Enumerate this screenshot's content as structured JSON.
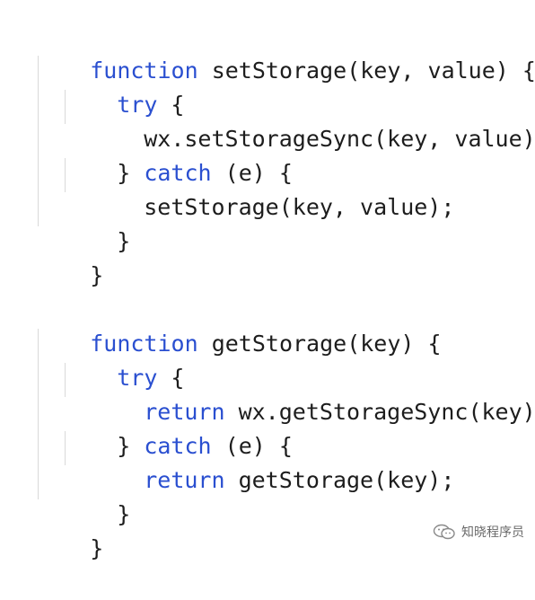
{
  "code": {
    "lines": [
      {
        "indent": 0,
        "keyword": "function",
        "text": " setStorage(key, value) {"
      },
      {
        "indent": 1,
        "keyword": "try",
        "text": " {"
      },
      {
        "indent": 2,
        "keyword": "",
        "text": "wx.setStorageSync(key, value);"
      },
      {
        "indent": 1,
        "keyword": "",
        "text": "} ",
        "keyword2": "catch",
        "text2": " (e) {"
      },
      {
        "indent": 2,
        "keyword": "",
        "text": "setStorage(key, value);"
      },
      {
        "indent": 1,
        "keyword": "",
        "text": "}"
      },
      {
        "indent": 0,
        "keyword": "",
        "text": "}"
      },
      {
        "indent": 0,
        "keyword": "",
        "text": ""
      },
      {
        "indent": 0,
        "keyword": "function",
        "text": " getStorage(key) {"
      },
      {
        "indent": 1,
        "keyword": "try",
        "text": " {"
      },
      {
        "indent": 2,
        "keyword": "return",
        "text": " wx.getStorageSync(key);"
      },
      {
        "indent": 1,
        "keyword": "",
        "text": "} ",
        "keyword2": "catch",
        "text2": " (e) {"
      },
      {
        "indent": 2,
        "keyword": "return",
        "text": " getStorage(key);"
      },
      {
        "indent": 1,
        "keyword": "",
        "text": "}"
      },
      {
        "indent": 0,
        "keyword": "",
        "text": "}"
      }
    ]
  },
  "watermark": {
    "text": "知晓程序员",
    "icon": "wechat-icon"
  },
  "colors": {
    "keyword": "#2a4fd0",
    "text": "#1d1d1d",
    "guide": "#d9d9d9",
    "background": "#ffffff"
  }
}
